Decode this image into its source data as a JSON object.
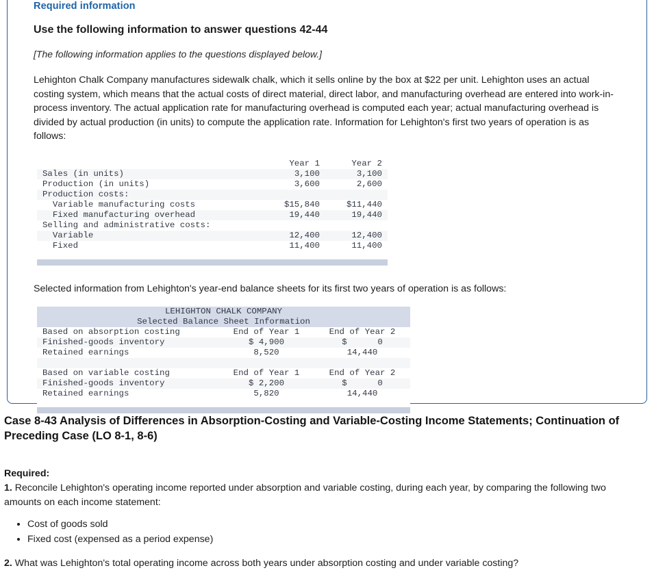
{
  "card": {
    "required_information_label": "Required information",
    "title": "Use the following information to answer questions 42-44",
    "note": "[The following information applies to the questions displayed below.]",
    "paragraph": "Lehighton Chalk Company manufactures sidewalk chalk, which it sells online by the box at $22 per unit. Lehighton uses an actual costing system, which means that the actual costs of direct material, direct labor, and manufacturing overhead are entered into work-in-process inventory. The actual application rate for manufacturing overhead is computed each year; actual manufacturing overhead is divided by actual production (in units) to compute the application rate. Information for Lehighton's first two years of operation is as follows:",
    "paragraph2": "Selected information from Lehighton's year-end balance sheets for its first two years of operation is as follows:"
  },
  "table_one": {
    "headers": [
      "",
      "Year 1",
      "Year 2"
    ],
    "rows": [
      {
        "label": "Sales (in units)",
        "year1": "3,100",
        "year2": "3,100"
      },
      {
        "label": "Production (in units)",
        "year1": "3,600",
        "year2": "2,600"
      },
      {
        "label": "Production costs:",
        "year1": "",
        "year2": ""
      },
      {
        "label": "  Variable manufacturing costs",
        "year1": "$15,840",
        "year2": "$11,440"
      },
      {
        "label": "  Fixed manufacturing overhead",
        "year1": "19,440",
        "year2": "19,440"
      },
      {
        "label": "Selling and administrative costs:",
        "year1": "",
        "year2": ""
      },
      {
        "label": "  Variable",
        "year1": "12,400",
        "year2": "12,400"
      },
      {
        "label": "  Fixed",
        "year1": "11,400",
        "year2": "11,400"
      }
    ]
  },
  "table_two": {
    "title_line1": "LEHIGHTON CHALK COMPANY",
    "title_line2": "Selected Balance Sheet Information",
    "section_a": {
      "header_label": "Based on absorption costing",
      "header_year1": "End of Year 1",
      "header_year2": "End of Year 2",
      "rows": [
        {
          "label": "Finished-goods inventory",
          "year1": "$ 4,900",
          "year2": "$      0"
        },
        {
          "label": "Retained earnings",
          "year1": "8,520",
          "year2": "14,440"
        }
      ]
    },
    "section_b": {
      "header_label": "Based on variable costing",
      "header_year1": "End of Year 1",
      "header_year2": "End of Year 2",
      "rows": [
        {
          "label": "Finished-goods inventory",
          "year1": "$ 2,200",
          "year2": "$      0"
        },
        {
          "label": "Retained earnings",
          "year1": "5,820",
          "year2": "14,440"
        }
      ]
    }
  },
  "case": {
    "heading": "Case 8-43 Analysis of Differences in Absorption-Costing and Variable-Costing Income Statements; Continuation of Preceding Case (LO 8-1, 8-6)",
    "required_label": "Required:",
    "item1_number": "1.",
    "item1_text": " Reconcile Lehighton's operating income reported under absorption and variable costing, during each year, by comparing the following two amounts on each income statement:",
    "bullets": [
      "Cost of goods sold",
      "Fixed cost (expensed as a period expense)"
    ],
    "item2_number": "2.",
    "item2_text": " What was Lehighton's total operating income across both years under absorption costing and under variable costing?"
  },
  "colors": {
    "card_border": "#2b5d97",
    "required_label": "#1e63a8",
    "table_header_band": "#d4dae8",
    "table_footer_band": "#c8cfdf",
    "table_alt_row": "#f5f6f7",
    "body_text": "#1d1d1d"
  }
}
